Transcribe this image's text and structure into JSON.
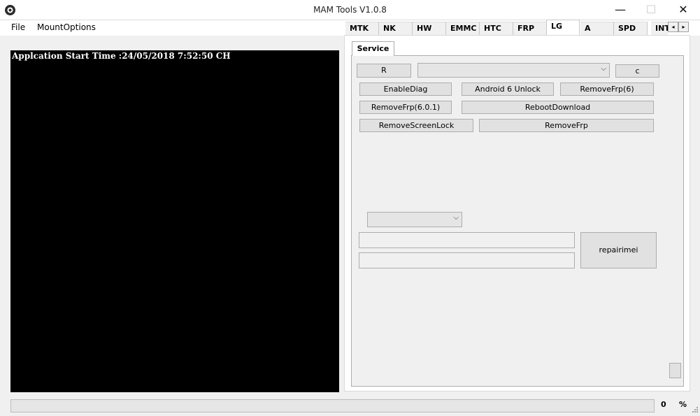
{
  "window": {
    "title": "MAM Tools V1.0.8",
    "icons": {
      "app": "app-logo-icon",
      "minimize": "minimize-icon",
      "maximize": "maximize-icon",
      "close": "close-icon"
    },
    "minimize_glyph": "—",
    "maximize_glyph": "☐",
    "close_glyph": "✕"
  },
  "menu": {
    "file": "File",
    "mount_options": "MountOptions"
  },
  "console": {
    "log_line": "Applcation Start Time :24/05/2018 7:52:50 CH"
  },
  "tabs": [
    {
      "label": "MTK"
    },
    {
      "label": "NK"
    },
    {
      "label": "HW"
    },
    {
      "label": "EMMC"
    },
    {
      "label": "HTC"
    },
    {
      "label": "FRP"
    },
    {
      "label": "LG",
      "active": true
    },
    {
      "label": "A"
    },
    {
      "label": "SPD"
    },
    {
      "label": "INTI"
    }
  ],
  "tab_scroll": {
    "left": "◂",
    "right": "▸"
  },
  "service": {
    "tab_label": "Service",
    "r_button": "R",
    "c_button": "c",
    "port_combo_value": "",
    "chevron": "⌵",
    "buttons": {
      "enable_diag": "EnableDiag",
      "android6_unlock": "Android 6 Unlock",
      "remove_frp_6": "RemoveFrp(6)",
      "remove_frp_601": "RemoveFrp(6.0.1)",
      "reboot_download": "RebootDownload",
      "remove_screen_lock": "RemoveScreenLock",
      "remove_frp": "RemoveFrp",
      "repair_imei": "repairimei"
    },
    "model_combo_value": "",
    "imei1_value": "",
    "imei2_value": ""
  },
  "status": {
    "progress_percent": 0,
    "progress_value": "0",
    "percent_sign": "%"
  }
}
